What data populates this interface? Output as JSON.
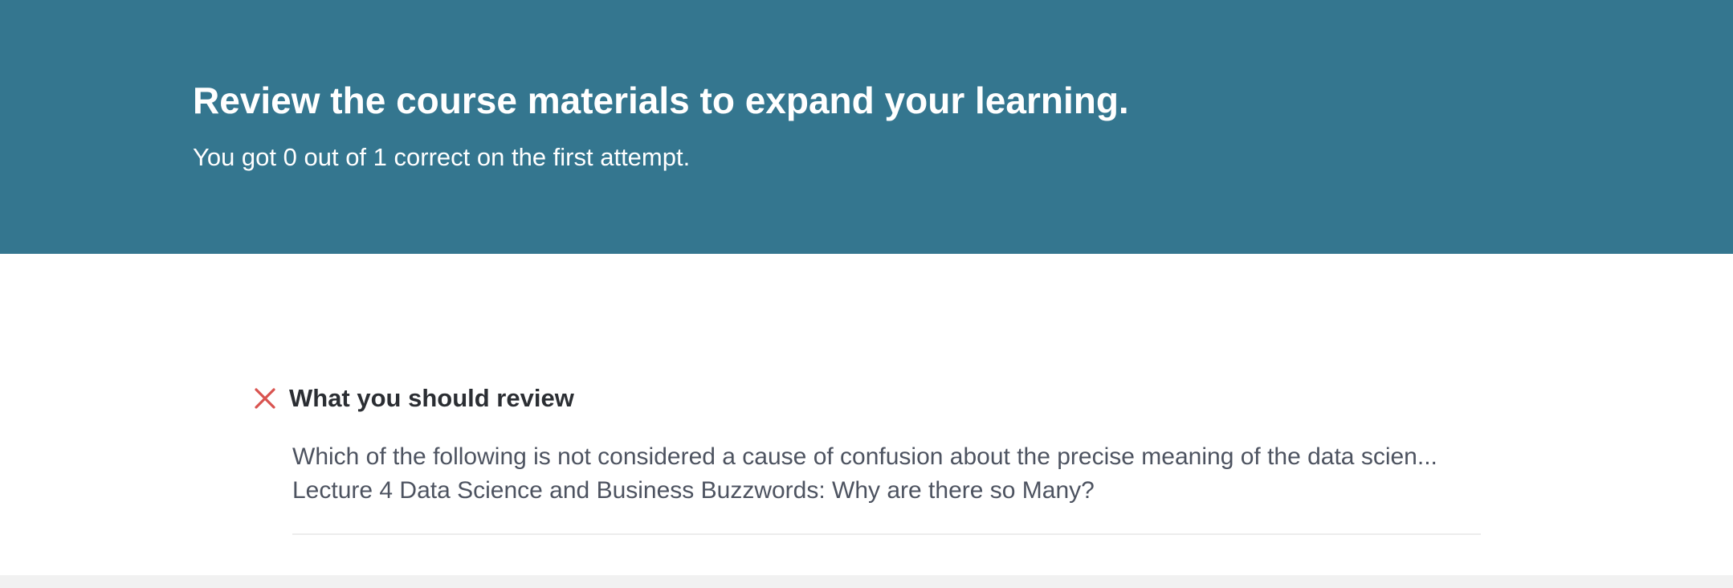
{
  "banner": {
    "title": "Review the course materials to expand your learning.",
    "subtitle": "You got 0 out of 1 correct on the first attempt.",
    "background_color": "#34768f"
  },
  "review": {
    "status_icon": "x-icon",
    "status_color": "#d9534f",
    "title": "What you should review",
    "items": [
      {
        "question": "Which of the following is not considered a cause of confusion about the precise meaning of the data scien...",
        "lecture": "Lecture 4 Data Science and Business Buzzwords: Why are there so Many?"
      }
    ]
  }
}
